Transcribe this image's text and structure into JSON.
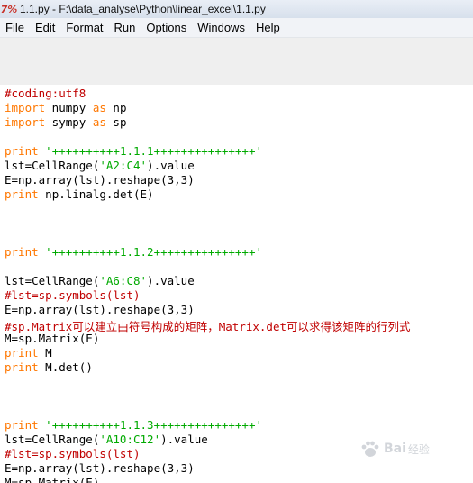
{
  "window": {
    "icon_text": "7%",
    "title": "1.1.py - F:\\data_analyse\\Python\\linear_excel\\1.1.py"
  },
  "menu": [
    "File",
    "Edit",
    "Format",
    "Run",
    "Options",
    "Windows",
    "Help"
  ],
  "code_lines": [
    [
      {
        "t": "#coding:utf8",
        "k": "comment"
      }
    ],
    [
      {
        "t": "import",
        "k": "keyword"
      },
      {
        "t": " numpy ",
        "k": "plain"
      },
      {
        "t": "as",
        "k": "keyword"
      },
      {
        "t": " np",
        "k": "plain"
      }
    ],
    [
      {
        "t": "import",
        "k": "keyword"
      },
      {
        "t": " sympy ",
        "k": "plain"
      },
      {
        "t": "as",
        "k": "keyword"
      },
      {
        "t": " sp",
        "k": "plain"
      }
    ],
    [],
    [
      {
        "t": "print",
        "k": "keyword"
      },
      {
        "t": " ",
        "k": "plain"
      },
      {
        "t": "'++++++++++1.1.1+++++++++++++++'",
        "k": "string"
      }
    ],
    [
      {
        "t": "lst=CellRange(",
        "k": "plain"
      },
      {
        "t": "'A2:C4'",
        "k": "string"
      },
      {
        "t": ").value",
        "k": "plain"
      }
    ],
    [
      {
        "t": "E=np.array(lst).reshape(3,3)",
        "k": "plain"
      }
    ],
    [
      {
        "t": "print",
        "k": "keyword"
      },
      {
        "t": " np.linalg.det(E)",
        "k": "plain"
      }
    ],
    [],
    [],
    [],
    [
      {
        "t": "print",
        "k": "keyword"
      },
      {
        "t": " ",
        "k": "plain"
      },
      {
        "t": "'++++++++++1.1.2+++++++++++++++'",
        "k": "string"
      }
    ],
    [],
    [
      {
        "t": "lst=CellRange(",
        "k": "plain"
      },
      {
        "t": "'A6:C8'",
        "k": "string"
      },
      {
        "t": ").value",
        "k": "plain"
      }
    ],
    [
      {
        "t": "#lst=sp.symbols(lst)",
        "k": "comment"
      }
    ],
    [
      {
        "t": "E=np.array(lst).reshape(3,3)",
        "k": "plain"
      }
    ],
    [
      {
        "t": "#sp.Matrix可以建立由符号构成的矩阵，Matrix.det可以求得该矩阵的行列式",
        "k": "comment"
      }
    ],
    [
      {
        "t": "M=sp.Matrix(E)",
        "k": "plain"
      }
    ],
    [
      {
        "t": "print",
        "k": "keyword"
      },
      {
        "t": " M",
        "k": "plain"
      }
    ],
    [
      {
        "t": "print",
        "k": "keyword"
      },
      {
        "t": " M.det()",
        "k": "plain"
      }
    ],
    [],
    [],
    [],
    [
      {
        "t": "print",
        "k": "keyword"
      },
      {
        "t": " ",
        "k": "plain"
      },
      {
        "t": "'++++++++++1.1.3+++++++++++++++'",
        "k": "string"
      }
    ],
    [
      {
        "t": "lst=CellRange(",
        "k": "plain"
      },
      {
        "t": "'A10:C12'",
        "k": "string"
      },
      {
        "t": ").value",
        "k": "plain"
      }
    ],
    [
      {
        "t": "#lst=sp.symbols(lst)",
        "k": "comment"
      }
    ],
    [
      {
        "t": "E=np.array(lst).reshape(3,3)",
        "k": "plain"
      }
    ],
    [
      {
        "t": "M=sp.Matrix(E)",
        "k": "plain"
      }
    ]
  ],
  "watermark": {
    "brand": "Bai",
    "cn": "经验"
  }
}
